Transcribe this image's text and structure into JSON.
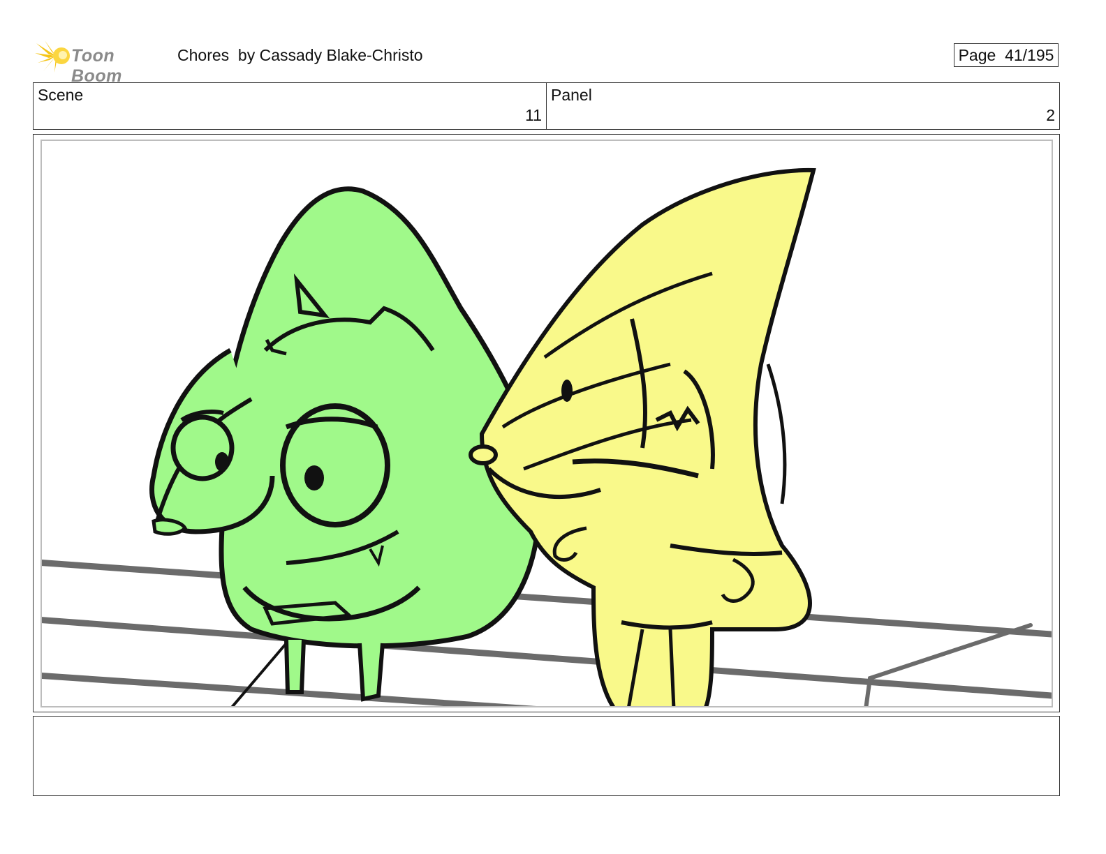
{
  "header": {
    "logo_text": "Toon Boom",
    "title": "Chores  by Cassady Blake-Christo",
    "page_label": "Page  41/195"
  },
  "info": {
    "scene_label": "Scene",
    "scene_value": "11",
    "panel_label": "Panel",
    "panel_value": "2"
  },
  "panel_image": {
    "description_colors": {
      "green_character_fill": "#a0f98a",
      "yellow_character_fill": "#f9f98a",
      "rail_color": "#6b6b6b",
      "line_color": "#111111"
    }
  },
  "notes": {
    "text": ""
  }
}
